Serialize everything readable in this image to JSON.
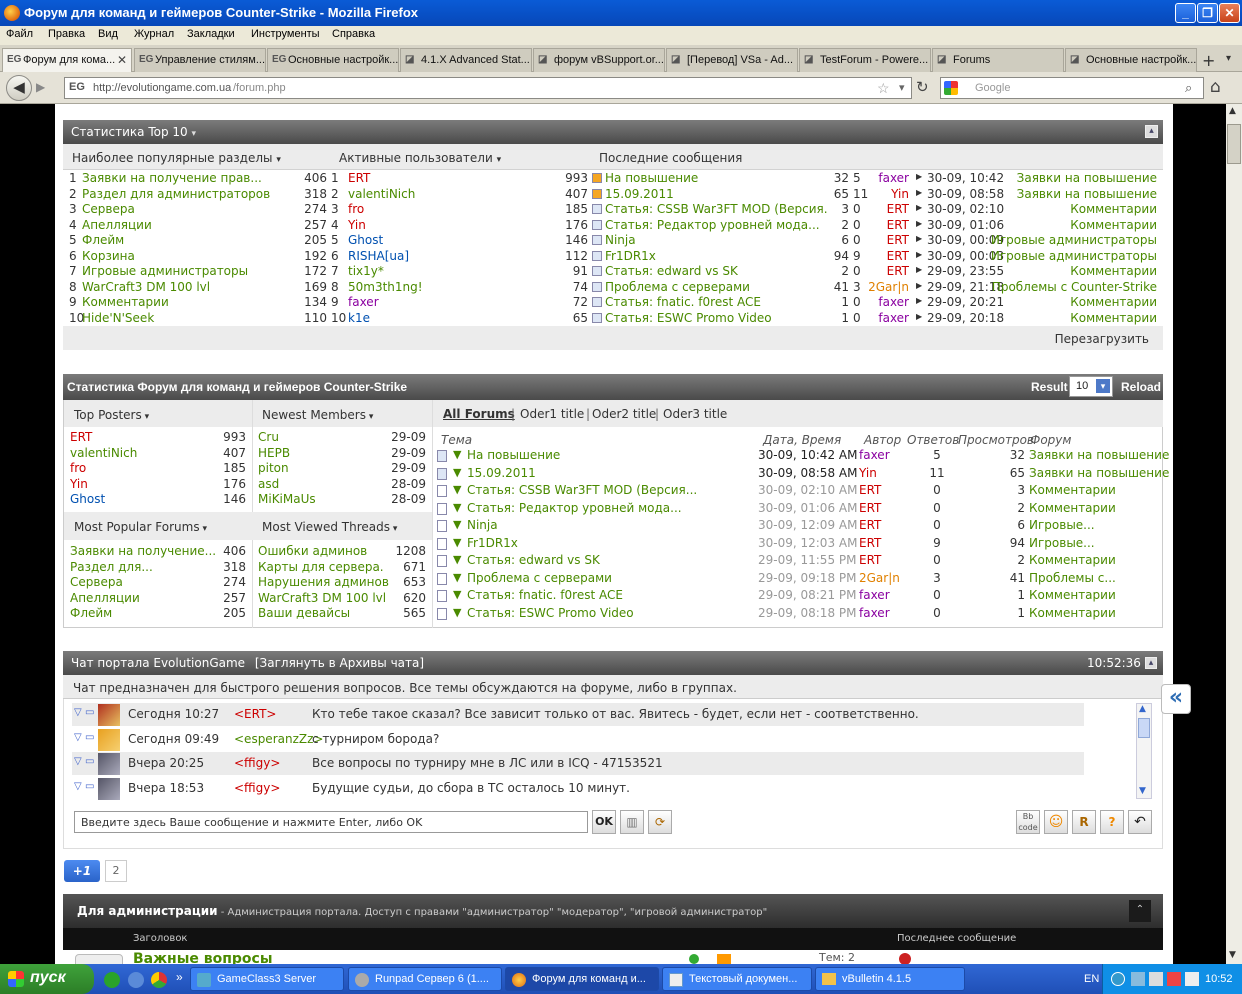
{
  "window": {
    "title": "Форум для команд и геймеров Counter-Strike - Mozilla Firefox"
  },
  "menu": [
    "Файл",
    "Правка",
    "Вид",
    "Журнал",
    "Закладки",
    "Инструменты",
    "Справка"
  ],
  "tabs": [
    {
      "label": "Форум для кома...",
      "icon": "EG"
    },
    {
      "label": "Управление стилям...",
      "icon": "EG"
    },
    {
      "label": "Основные настройк...",
      "icon": "EG"
    },
    {
      "label": "4.1.X Advanced Stat...",
      "icon": "x"
    },
    {
      "label": "форум vBSupport.or...",
      "icon": "x"
    },
    {
      "label": "[Перевод] VSa - Ad...",
      "icon": "x"
    },
    {
      "label": "TestForum - Powere...",
      "icon": "x"
    },
    {
      "label": "Forums",
      "icon": "x"
    },
    {
      "label": "Основные настройк...",
      "icon": "x"
    }
  ],
  "nav": {
    "url": "http://evolutiongame.com.ua/forum.php",
    "url_host": "http://evolutiongame.com.ua",
    "url_path": "/forum.php",
    "search_placeholder": "Google",
    "site_icon": "EG"
  },
  "top10": {
    "title": "Статистика Top 10",
    "col1": "Наиболее популярные разделы",
    "col2": "Активные пользователи",
    "col3": "Последние сообщения",
    "reload": "Перезагрузить",
    "sections": [
      {
        "n": "1",
        "name": "Заявки на получение прав...",
        "v": "406"
      },
      {
        "n": "2",
        "name": "Раздел для администраторов",
        "v": "318"
      },
      {
        "n": "3",
        "name": "Сервера",
        "v": "274"
      },
      {
        "n": "4",
        "name": "Апелляции",
        "v": "257"
      },
      {
        "n": "5",
        "name": "Флейм",
        "v": "205"
      },
      {
        "n": "6",
        "name": "Корзина",
        "v": "192"
      },
      {
        "n": "7",
        "name": "Игровые администраторы",
        "v": "172"
      },
      {
        "n": "8",
        "name": "WarCraft3 DM 100 lvl",
        "v": "169"
      },
      {
        "n": "9",
        "name": "Комментарии",
        "v": "134"
      },
      {
        "n": "10",
        "name": "Hide'N'Seek",
        "v": "110"
      }
    ],
    "users": [
      {
        "n": "1",
        "name": "ERT",
        "v": "993",
        "c": "r"
      },
      {
        "n": "2",
        "name": "valentiNich",
        "v": "407",
        "c": "g"
      },
      {
        "n": "3",
        "name": "fro",
        "v": "185",
        "c": "r"
      },
      {
        "n": "4",
        "name": "Yin",
        "v": "176",
        "c": "r"
      },
      {
        "n": "5",
        "name": "Ghost",
        "v": "146",
        "c": "b"
      },
      {
        "n": "6",
        "name": "RISHA[ua]",
        "v": "112",
        "c": "b"
      },
      {
        "n": "7",
        "name": "tix1y*",
        "v": "91",
        "c": "g"
      },
      {
        "n": "8",
        "name": "50m3th1ng!",
        "v": "74",
        "c": "g"
      },
      {
        "n": "9",
        "name": "faxer",
        "v": "72",
        "c": "p"
      },
      {
        "n": "10",
        "name": "k1e",
        "v": "65",
        "c": "b"
      }
    ],
    "posts": [
      {
        "t": "На повышение",
        "a": "32",
        "b": "5",
        "u": "faxer",
        "uc": "p",
        "d": "30-09, 10:42",
        "f": "Заявки на повышение"
      },
      {
        "t": "15.09.2011",
        "a": "65",
        "b": "11",
        "u": "Yin",
        "uc": "r",
        "d": "30-09, 08:58",
        "f": "Заявки на повышение"
      },
      {
        "t": "Статья: CSSB War3FT MOD (Версия...",
        "a": "3",
        "b": "0",
        "u": "ERT",
        "uc": "r",
        "d": "30-09, 02:10",
        "f": "Комментарии"
      },
      {
        "t": "Статья: Редактор уровней мода...",
        "a": "2",
        "b": "0",
        "u": "ERT",
        "uc": "r",
        "d": "30-09, 01:06",
        "f": "Комментарии"
      },
      {
        "t": "Ninja",
        "a": "6",
        "b": "0",
        "u": "ERT",
        "uc": "r",
        "d": "30-09, 00:09",
        "f": "Игровые администраторы"
      },
      {
        "t": "Fr1DR1x",
        "a": "94",
        "b": "9",
        "u": "ERT",
        "uc": "r",
        "d": "30-09, 00:03",
        "f": "Игровые администраторы"
      },
      {
        "t": "Статья: edward vs SK",
        "a": "2",
        "b": "0",
        "u": "ERT",
        "uc": "r",
        "d": "29-09, 23:55",
        "f": "Комментарии"
      },
      {
        "t": "Проблема с серверами",
        "a": "41",
        "b": "3",
        "u": "2Gar|n",
        "uc": "o",
        "d": "29-09, 21:18",
        "f": "Проблемы с Counter-Strike"
      },
      {
        "t": "Статья: fnatic. f0rest ACE",
        "a": "1",
        "b": "0",
        "u": "faxer",
        "uc": "p",
        "d": "29-09, 20:21",
        "f": "Комментарии"
      },
      {
        "t": "Статья: ESWC Promo Video",
        "a": "1",
        "b": "0",
        "u": "faxer",
        "uc": "p",
        "d": "29-09, 20:18",
        "f": "Комментарии"
      }
    ]
  },
  "stats": {
    "title": "Статистика Форум для команд и геймеров Counter-Strike",
    "result_label": "Result",
    "result_value": "10",
    "reload": "Reload",
    "top_posters_title": "Top Posters",
    "newest_title": "Newest Members",
    "top_posters": [
      {
        "name": "ERT",
        "v": "993",
        "c": "r"
      },
      {
        "name": "valentiNich",
        "v": "407",
        "c": "g"
      },
      {
        "name": "fro",
        "v": "185",
        "c": "r"
      },
      {
        "name": "Yin",
        "v": "176",
        "c": "r"
      },
      {
        "name": "Ghost",
        "v": "146",
        "c": "b"
      }
    ],
    "newest": [
      {
        "name": "Cru",
        "d": "29-09"
      },
      {
        "name": "HEPB",
        "d": "29-09"
      },
      {
        "name": "piton",
        "d": "29-09"
      },
      {
        "name": "asd",
        "d": "28-09"
      },
      {
        "name": "MiKiMaUs",
        "d": "28-09"
      }
    ],
    "popular_title": "Most Popular Forums",
    "viewed_title": "Most Viewed Threads",
    "popular": [
      {
        "name": "Заявки на получение...",
        "v": "406"
      },
      {
        "name": "Раздел для...",
        "v": "318"
      },
      {
        "name": "Сервера",
        "v": "274"
      },
      {
        "name": "Апелляции",
        "v": "257"
      },
      {
        "name": "Флейм",
        "v": "205"
      }
    ],
    "viewed": [
      {
        "name": "Ошибки админов",
        "v": "1208"
      },
      {
        "name": "Карты для сервера.",
        "v": "671"
      },
      {
        "name": "Нарушения админов",
        "v": "653"
      },
      {
        "name": "WarCraft3 DM 100 lvl",
        "v": "620"
      },
      {
        "name": "Ваши девайсы",
        "v": "565"
      }
    ],
    "filters": [
      "All Forums",
      "Oder1 title",
      "Oder2 title",
      "Oder3 title"
    ],
    "th": {
      "topic": "Тема",
      "date": "Дата, Время",
      "author": "Автор",
      "replies": "Ответов",
      "views": "Просмотров",
      "forum": "Форум"
    },
    "threads": [
      {
        "t": "На повышение",
        "d": "30-09, 10:42 AM",
        "u": "faxer",
        "uc": "p",
        "r": "5",
        "v": "32",
        "f": "Заявки на повышение",
        "fc": "g",
        "dc": "dk"
      },
      {
        "t": "15.09.2011",
        "d": "30-09, 08:58 AM",
        "u": "Yin",
        "uc": "r",
        "r": "11",
        "v": "65",
        "f": "Заявки на повышение",
        "fc": "g",
        "dc": "dk"
      },
      {
        "t": "Статья: CSSB War3FT MOD (Версия...",
        "d": "30-09, 02:10 AM",
        "u": "ERT",
        "uc": "r",
        "r": "0",
        "v": "3",
        "f": "Комментарии",
        "fc": "g",
        "dc": "gr"
      },
      {
        "t": "Статья: Редактор уровней мода...",
        "d": "30-09, 01:06 AM",
        "u": "ERT",
        "uc": "r",
        "r": "0",
        "v": "2",
        "f": "Комментарии",
        "fc": "g",
        "dc": "gr"
      },
      {
        "t": "Ninja",
        "d": "30-09, 12:09 AM",
        "u": "ERT",
        "uc": "r",
        "r": "0",
        "v": "6",
        "f": "Игровые...",
        "fc": "g",
        "dc": "gr"
      },
      {
        "t": "Fr1DR1x",
        "d": "30-09, 12:03 AM",
        "u": "ERT",
        "uc": "r",
        "r": "9",
        "v": "94",
        "f": "Игровые...",
        "fc": "g",
        "dc": "gr"
      },
      {
        "t": "Статья: edward vs SK",
        "d": "29-09, 11:55 PM",
        "u": "ERT",
        "uc": "r",
        "r": "0",
        "v": "2",
        "f": "Комментарии",
        "fc": "g",
        "dc": "gr"
      },
      {
        "t": "Проблема с серверами",
        "d": "29-09, 09:18 PM",
        "u": "2Gar|n",
        "uc": "o",
        "r": "3",
        "v": "41",
        "f": "Проблемы с...",
        "fc": "g",
        "dc": "gr"
      },
      {
        "t": "Статья: fnatic. f0rest ACE",
        "d": "29-09, 08:21 PM",
        "u": "faxer",
        "uc": "p",
        "r": "0",
        "v": "1",
        "f": "Комментарии",
        "fc": "g",
        "dc": "gr"
      },
      {
        "t": "Статья: ESWC Promo Video",
        "d": "29-09, 08:18 PM",
        "u": "faxer",
        "uc": "p",
        "r": "0",
        "v": "1",
        "f": "Комментарии",
        "fc": "g",
        "dc": "gr"
      }
    ]
  },
  "chat": {
    "title": "Чат портала EvolutionGame",
    "archive": "[Заглянуть в Архивы чата]",
    "time": "10:52:36",
    "notice": "Чат предназначен для быстрого решения вопросов. Все темы обсуждаются на форуме, либо в группах.",
    "messages": [
      {
        "when": "Сегодня 10:27",
        "user": "<ERT>",
        "uc": "r",
        "text": "Кто тебе такое сказал? Все зависит только от вас. Явитесь - будет, если нет - соответственно."
      },
      {
        "when": "Сегодня 09:49",
        "user": "<esperanzZz>",
        "uc": "g",
        "text": "с турниром борода?"
      },
      {
        "when": "Вчера 20:25",
        "user": "<ffigy>",
        "uc": "r",
        "text": "Все вопросы по турниру мне в ЛС или в ICQ - 47153521"
      },
      {
        "when": "Вчера 18:53",
        "user": "<ffigy>",
        "uc": "r",
        "text": "Будущие судьи, до сбора в ТС осталось 10 минут."
      }
    ],
    "input_placeholder": "Введите здесь Ваше сообщение и нажмите Enter, либо OK",
    "ok": "OK"
  },
  "gplus": {
    "label": "+1",
    "count": "2"
  },
  "admin": {
    "title": "Для администрации",
    "desc": " - Администрация портала. Доступ с правами \"администратор\" \"модератор\", \"игровой администратор\"",
    "col_title": "Заголовок",
    "col_last": "Последнее сообщение",
    "row_title": "Важные вопросы",
    "row_topics": "Тем: 2"
  },
  "taskbar": {
    "start": "пуск",
    "items": [
      "GameClass3 Server",
      "Runpad Сервер 6 (1....",
      "Форум для команд и...",
      "Текстовый докумен...",
      "vBulletin 4.1.5"
    ],
    "lang": "EN",
    "clock": "10:52"
  }
}
